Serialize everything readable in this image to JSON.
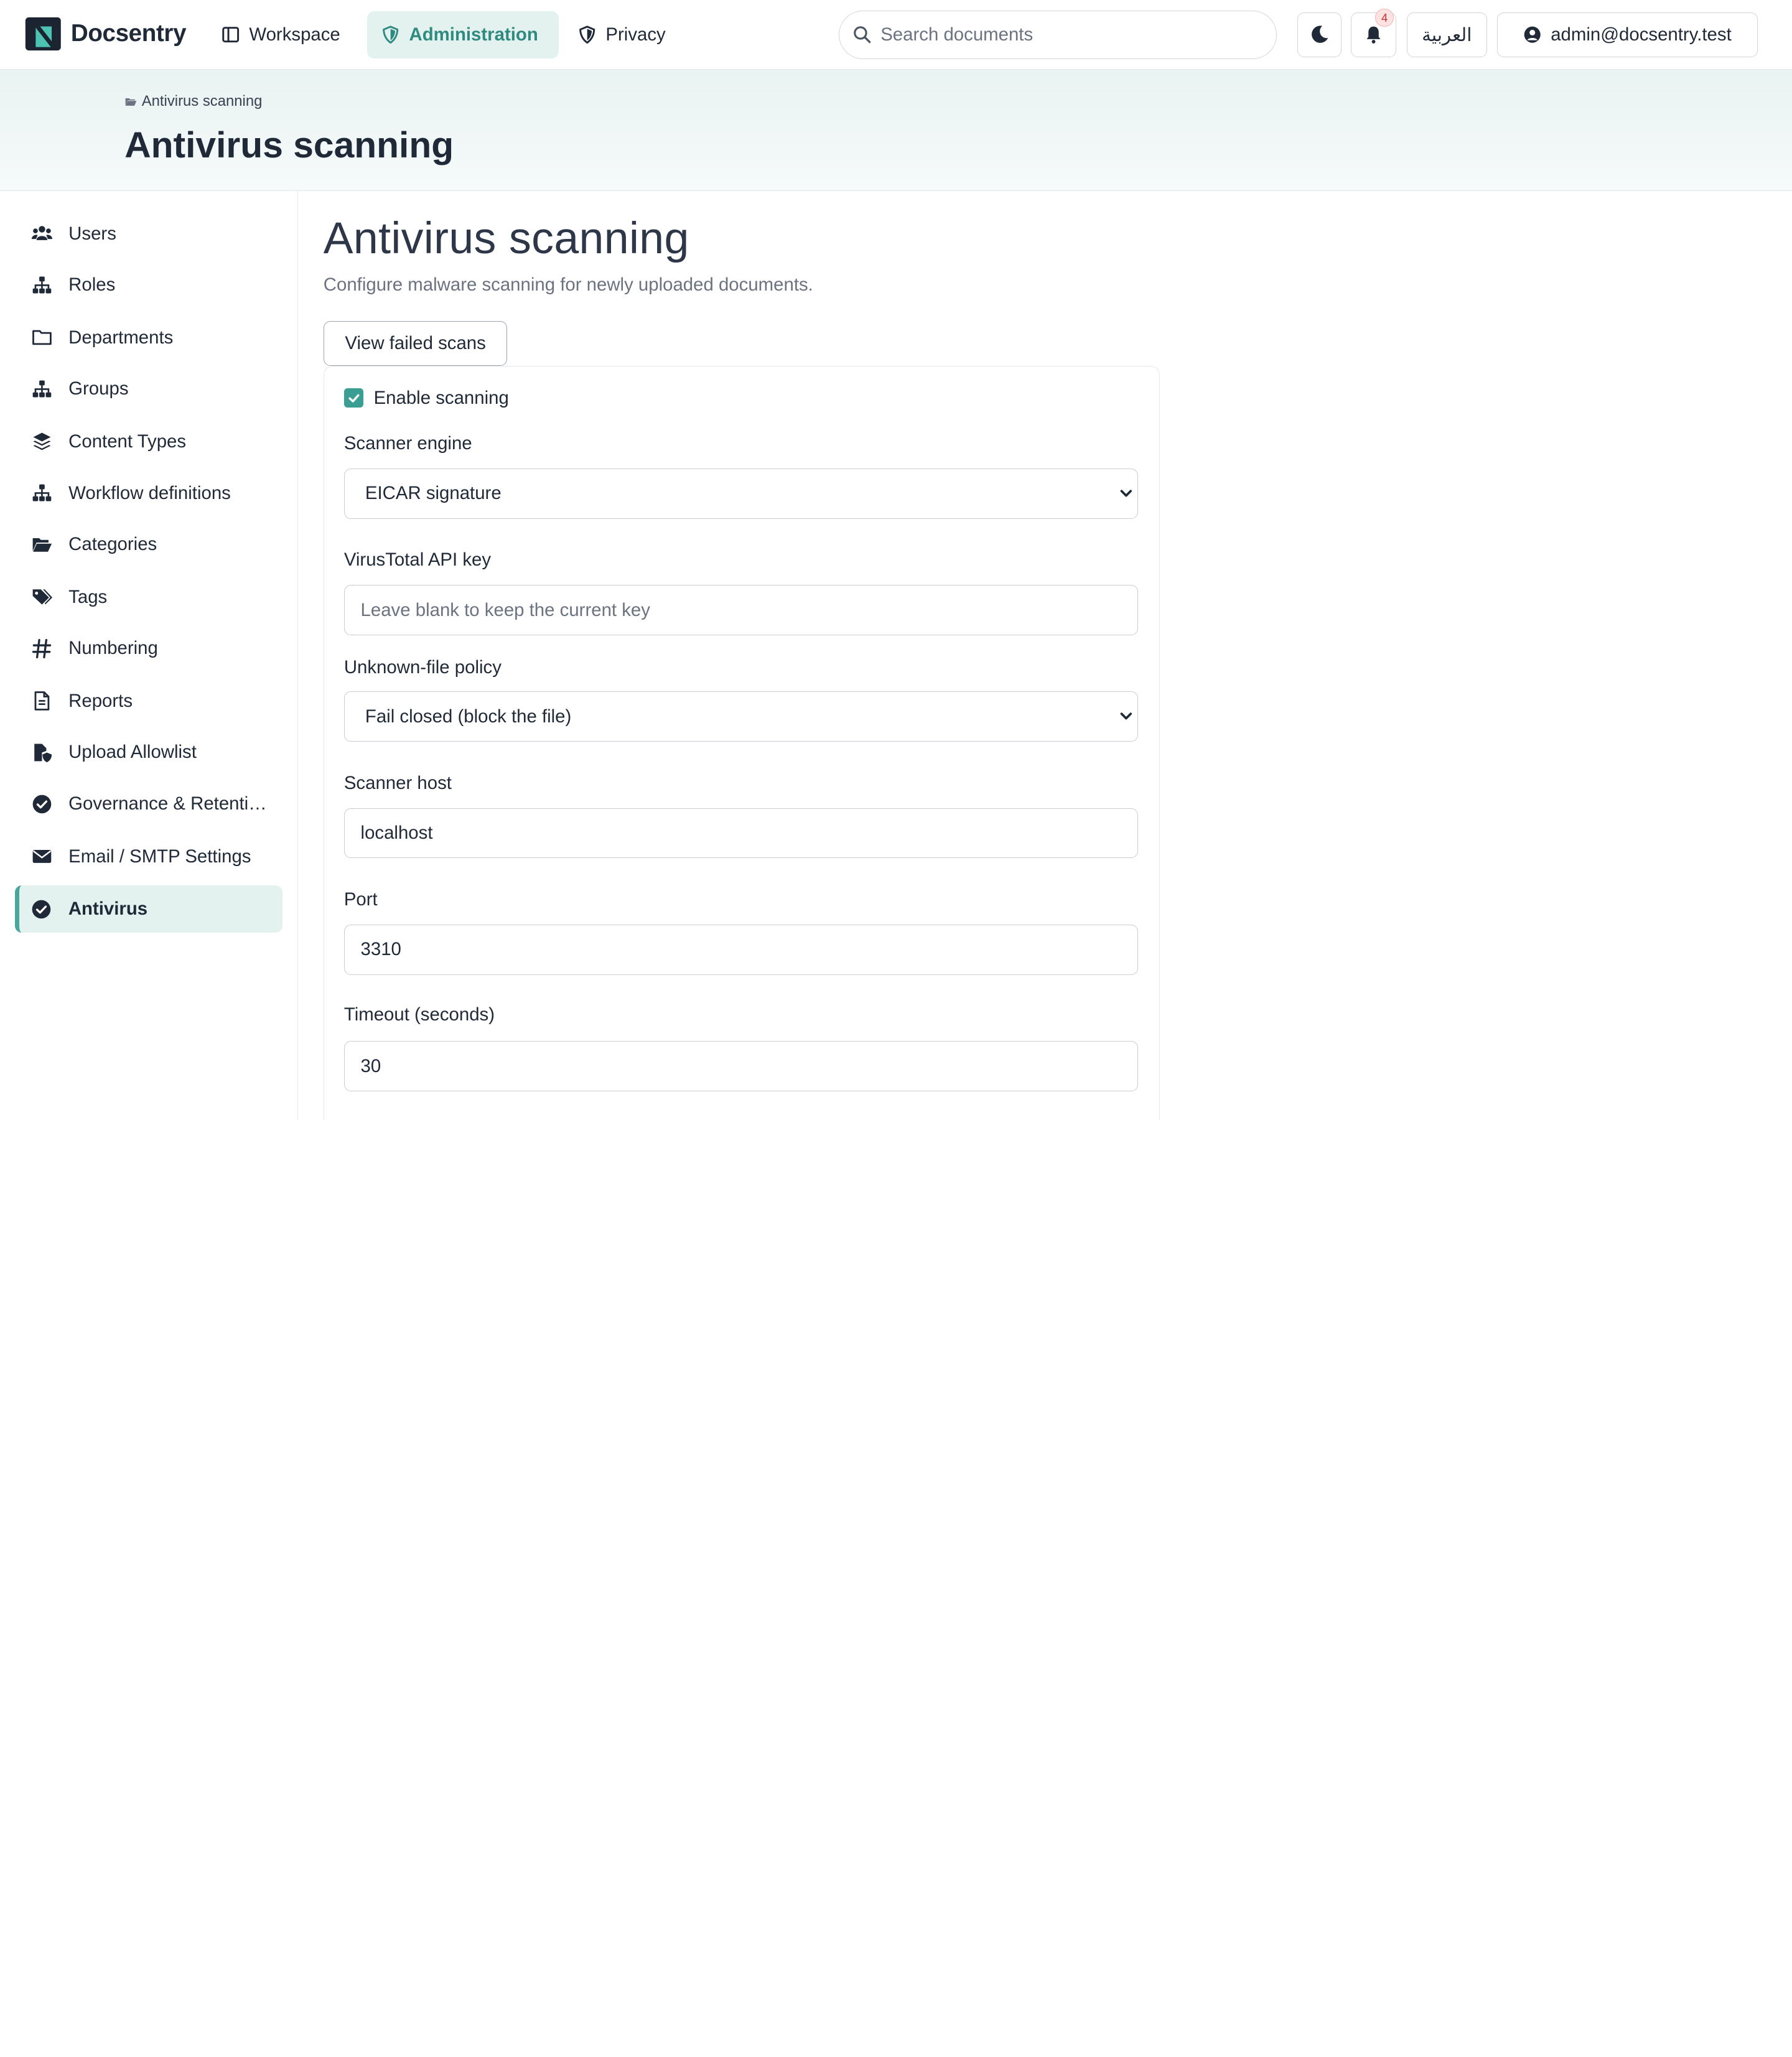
{
  "brand": {
    "name": "Docsentry"
  },
  "nav": [
    {
      "label": "Workspace",
      "icon": "columns-icon"
    },
    {
      "label": "Administration",
      "icon": "shield-icon"
    },
    {
      "label": "Privacy",
      "icon": "shield-half-icon"
    }
  ],
  "search": {
    "placeholder": "Search documents"
  },
  "notifications": {
    "count": "4"
  },
  "language": {
    "label": "العربية"
  },
  "user": {
    "email": "admin@docsentry.test"
  },
  "breadcrumb": {
    "label": "Antivirus scanning"
  },
  "header": {
    "title": "Antivirus scanning"
  },
  "sidebar": {
    "items": [
      {
        "label": "Users",
        "icon": "users-icon"
      },
      {
        "label": "Roles",
        "icon": "sitemap-icon"
      },
      {
        "label": "Departments",
        "icon": "folder-icon"
      },
      {
        "label": "Groups",
        "icon": "sitemap-icon"
      },
      {
        "label": "Content Types",
        "icon": "layers-icon"
      },
      {
        "label": "Workflow definitions",
        "icon": "sitemap-icon"
      },
      {
        "label": "Categories",
        "icon": "folder-open-icon"
      },
      {
        "label": "Tags",
        "icon": "tags-icon"
      },
      {
        "label": "Numbering",
        "icon": "hash-icon"
      },
      {
        "label": "Reports",
        "icon": "file-icon"
      },
      {
        "label": "Upload Allowlist",
        "icon": "file-shield-icon"
      },
      {
        "label": "Governance & Retention",
        "icon": "check-circle-icon"
      },
      {
        "label": "Email / SMTP Settings",
        "icon": "envelope-icon"
      },
      {
        "label": "Antivirus",
        "icon": "check-circle-icon"
      }
    ],
    "active": "Antivirus"
  },
  "main": {
    "title": "Antivirus scanning",
    "subtitle": "Configure malware scanning for newly uploaded documents.",
    "failed_button": "View failed scans",
    "form": {
      "enable_label": "Enable scanning",
      "enabled": true,
      "engine_label": "Scanner engine",
      "engine_value": "EICAR signature",
      "api_key_label": "VirusTotal API key",
      "api_key_placeholder": "Leave blank to keep the current key",
      "policy_label": "Unknown-file policy",
      "policy_value": "Fail closed (block the file)",
      "host_label": "Scanner host",
      "host_value": "localhost",
      "port_label": "Port",
      "port_value": "3310",
      "timeout_label": "Timeout (seconds)",
      "timeout_value": "30"
    }
  },
  "colors": {
    "accent": "#3a9e92",
    "active_bg": "#e3f1ef",
    "active_text": "#2f8a80"
  }
}
